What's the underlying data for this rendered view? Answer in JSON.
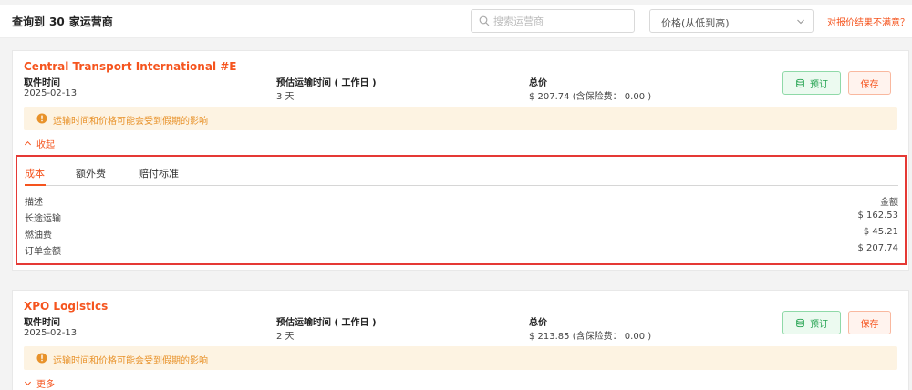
{
  "header": {
    "result_prefix": "查询到",
    "result_count": "30",
    "result_suffix": "家运营商",
    "search_placeholder": "搜索运营商",
    "sort_value": "价格(从低到高)",
    "unsatisfied_link": "对报价结果不满意？"
  },
  "labels": {
    "pickup_time": "取件时间",
    "transit_time": "预估运输时间 ( 工作日 )",
    "total_price": "总价",
    "book_button": "预订",
    "save_button": "保存",
    "warning": "运输时间和价格可能会受到假期的影响"
  },
  "carriers": [
    {
      "name": "Central Transport International #E",
      "pickup_date": "2025-02-13",
      "transit_days": "3 天",
      "total": "$  207.74  (含保险费： 0.00 )",
      "toggle_label": "收起"
    },
    {
      "name": "XPO Logistics",
      "pickup_date": "2025-02-13",
      "transit_days": "2 天",
      "total": "$  213.85  (含保险费： 0.00 )",
      "toggle_label": "更多"
    }
  ],
  "detail": {
    "tabs": [
      "成本",
      "额外费",
      "赔付标准"
    ],
    "header_desc": "描述",
    "header_amount": "金额",
    "rows": [
      {
        "desc": "长途运输",
        "amount": "$ 162.53"
      },
      {
        "desc": "燃油费",
        "amount": "$ 45.21"
      },
      {
        "desc": "订单金额",
        "amount": "$  207.74"
      }
    ]
  },
  "colors": {
    "accent": "#f5541e",
    "success": "#27a453",
    "warning": "#e8922a",
    "highlight_border": "#e53935"
  }
}
